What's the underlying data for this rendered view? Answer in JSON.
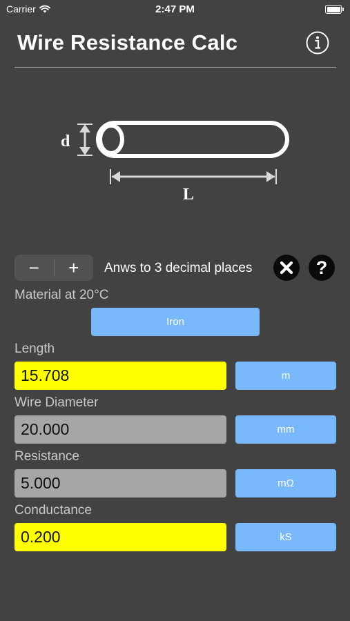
{
  "status_bar": {
    "carrier": "Carrier",
    "time": "2:47 PM",
    "icons": [
      "wifi-icon",
      "battery-icon"
    ]
  },
  "header": {
    "title": "Wire Resistance Calc",
    "info_icon": "info-icon"
  },
  "diagram": {
    "diameter_label": "d",
    "length_label": "L"
  },
  "controls": {
    "minus_label": "−",
    "plus_label": "+",
    "decimal_text": "Anws to 3 decimal places",
    "clear_icon": "close-icon",
    "help_label": "?"
  },
  "material": {
    "label": "Material at 20°C",
    "value": "Iron"
  },
  "fields": {
    "length": {
      "label": "Length",
      "value": "15.708",
      "unit": "m",
      "color": "#ffff00"
    },
    "diameter": {
      "label": "Wire Diameter",
      "value": "20.000",
      "unit": "mm",
      "color": "#a6a6a6"
    },
    "resistance": {
      "label": "Resistance",
      "value": "5.000",
      "unit": "mΩ",
      "color": "#a6a6a6"
    },
    "conductance": {
      "label": "Conductance",
      "value": "0.200",
      "unit": "kS",
      "color": "#ffff00"
    }
  },
  "colors": {
    "background": "#424242",
    "unit_button": "#78b8fb",
    "input_highlight": "#ffff00",
    "input_disabled": "#a6a6a6"
  }
}
